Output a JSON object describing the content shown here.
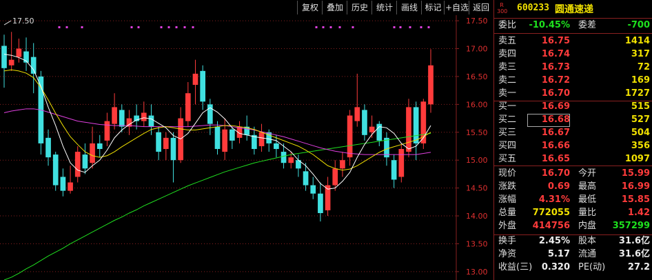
{
  "toolbar": {
    "items": [
      "复权",
      "叠加",
      "历史",
      "统计",
      "画线",
      "标记",
      "+自选",
      "返回"
    ]
  },
  "chart": {
    "y_labels": [
      "17.50",
      "17.00",
      "16.50",
      "16.00",
      "15.50",
      "15.00",
      "14.50",
      "14.00",
      "13.50",
      "13.00"
    ],
    "ymin": 12.85,
    "ymax": 17.6,
    "max_marker": "17.50",
    "colors": {
      "up": "#ff3b3b",
      "down": "#40e0e0",
      "ma5": "#ffffff",
      "ma10": "#f0e000",
      "ma20": "#e040e0",
      "ma60": "#20e020",
      "grid": "#8a2020",
      "dots": "#e040e0"
    },
    "candles": [
      [
        17.05,
        16.65,
        17.25,
        16.3
      ],
      [
        16.7,
        16.8,
        17.3,
        16.6
      ],
      [
        16.85,
        17.0,
        17.18,
        16.75
      ],
      [
        16.95,
        16.75,
        17.2,
        16.6
      ],
      [
        16.85,
        16.55,
        17.1,
        16.2
      ],
      [
        16.5,
        15.3,
        16.6,
        15.1
      ],
      [
        15.4,
        15.05,
        15.55,
        14.9
      ],
      [
        15.1,
        14.55,
        15.15,
        14.45
      ],
      [
        14.7,
        14.45,
        14.85,
        14.35
      ],
      [
        14.45,
        14.6,
        14.9,
        14.4
      ],
      [
        14.7,
        15.15,
        15.25,
        14.6
      ],
      [
        15.1,
        14.85,
        15.3,
        14.75
      ],
      [
        14.95,
        15.3,
        15.6,
        14.85
      ],
      [
        15.3,
        15.2,
        15.45,
        15.05
      ],
      [
        15.35,
        15.7,
        15.85,
        15.25
      ],
      [
        15.65,
        15.95,
        16.2,
        15.55
      ],
      [
        15.9,
        15.6,
        16.0,
        15.5
      ],
      [
        15.6,
        15.75,
        15.9,
        15.45
      ],
      [
        15.8,
        15.7,
        16.0,
        15.55
      ],
      [
        15.7,
        15.85,
        16.05,
        15.6
      ],
      [
        15.8,
        15.6,
        16.0,
        15.45
      ],
      [
        15.5,
        15.15,
        15.6,
        15.0
      ],
      [
        15.2,
        15.4,
        15.5,
        15.0
      ],
      [
        15.4,
        15.0,
        15.5,
        14.6
      ],
      [
        15.0,
        15.75,
        15.95,
        14.95
      ],
      [
        15.7,
        16.2,
        16.4,
        15.6
      ],
      [
        16.35,
        16.55,
        16.8,
        16.0
      ],
      [
        16.6,
        16.05,
        16.7,
        15.9
      ],
      [
        16.0,
        15.65,
        16.1,
        15.45
      ],
      [
        15.6,
        15.2,
        15.7,
        15.1
      ],
      [
        15.15,
        15.55,
        15.75,
        15.0
      ],
      [
        15.55,
        15.35,
        15.6,
        15.2
      ],
      [
        15.4,
        15.6,
        15.7,
        15.3
      ],
      [
        15.6,
        15.45,
        15.8,
        15.35
      ],
      [
        15.45,
        15.2,
        15.6,
        15.1
      ],
      [
        15.25,
        15.5,
        15.65,
        15.15
      ],
      [
        15.5,
        15.3,
        15.55,
        15.15
      ],
      [
        15.3,
        15.2,
        15.45,
        15.05
      ],
      [
        15.15,
        14.95,
        15.3,
        14.85
      ],
      [
        14.95,
        15.05,
        15.15,
        14.85
      ],
      [
        15.0,
        14.85,
        15.1,
        14.7
      ],
      [
        14.8,
        14.55,
        14.95,
        14.45
      ],
      [
        14.55,
        14.4,
        14.7,
        14.3
      ],
      [
        14.4,
        14.05,
        14.6,
        13.9
      ],
      [
        14.1,
        14.55,
        14.7,
        14.0
      ],
      [
        14.55,
        14.85,
        15.0,
        14.45
      ],
      [
        14.85,
        15.0,
        15.15,
        14.7
      ],
      [
        15.05,
        15.8,
        15.9,
        14.9
      ],
      [
        15.7,
        15.95,
        16.55,
        15.6
      ],
      [
        15.9,
        15.45,
        16.0,
        15.35
      ],
      [
        15.5,
        15.6,
        15.8,
        15.4
      ],
      [
        15.65,
        15.35,
        15.7,
        15.25
      ],
      [
        15.4,
        15.05,
        15.5,
        14.9
      ],
      [
        15.0,
        14.65,
        15.1,
        14.5
      ],
      [
        14.7,
        15.2,
        15.3,
        14.6
      ],
      [
        15.15,
        15.95,
        16.1,
        15.05
      ],
      [
        15.95,
        15.3,
        16.05,
        15.0
      ],
      [
        15.3,
        16.05,
        16.1,
        15.2
      ],
      [
        16.0,
        16.7,
        16.99,
        15.85
      ]
    ],
    "ma5": [
      16.9,
      16.88,
      16.84,
      16.78,
      16.62,
      16.32,
      15.95,
      15.62,
      15.25,
      14.95,
      14.82,
      14.78,
      14.9,
      15.0,
      15.18,
      15.4,
      15.54,
      15.64,
      15.72,
      15.76,
      15.74,
      15.66,
      15.58,
      15.44,
      15.38,
      15.48,
      15.66,
      15.85,
      15.94,
      15.86,
      15.74,
      15.58,
      15.48,
      15.45,
      15.42,
      15.4,
      15.38,
      15.35,
      15.25,
      15.15,
      15.0,
      14.9,
      14.75,
      14.58,
      14.48,
      14.5,
      14.62,
      14.78,
      15.05,
      15.28,
      15.46,
      15.6,
      15.58,
      15.48,
      15.3,
      15.2,
      15.25,
      15.4,
      15.62
    ],
    "ma10": [
      16.6,
      16.62,
      16.6,
      16.56,
      16.48,
      16.3,
      16.08,
      15.84,
      15.62,
      15.42,
      15.28,
      15.15,
      15.08,
      15.05,
      15.08,
      15.15,
      15.24,
      15.32,
      15.4,
      15.48,
      15.55,
      15.58,
      15.6,
      15.58,
      15.56,
      15.54,
      15.54,
      15.56,
      15.58,
      15.6,
      15.62,
      15.62,
      15.6,
      15.58,
      15.55,
      15.5,
      15.45,
      15.4,
      15.35,
      15.3,
      15.25,
      15.18,
      15.1,
      15.0,
      14.9,
      14.85,
      14.82,
      14.84,
      14.9,
      14.98,
      15.06,
      15.14,
      15.2,
      15.24,
      15.28,
      15.32,
      15.36,
      15.42,
      15.5
    ],
    "ma20": [
      15.85,
      15.88,
      15.9,
      15.92,
      15.92,
      15.9,
      15.86,
      15.82,
      15.78,
      15.74,
      15.7,
      15.68,
      15.66,
      15.64,
      15.63,
      15.62,
      15.62,
      15.62,
      15.61,
      15.6,
      15.6,
      15.6,
      15.6,
      15.6,
      15.6,
      15.6,
      15.61,
      15.62,
      15.63,
      15.63,
      15.62,
      15.6,
      15.58,
      15.56,
      15.54,
      15.51,
      15.48,
      15.45,
      15.42,
      15.38,
      15.34,
      15.3,
      15.26,
      15.22,
      15.19,
      15.16,
      15.14,
      15.12,
      15.11,
      15.1,
      15.1,
      15.1,
      15.1,
      15.1,
      15.1,
      15.1,
      15.1,
      15.12,
      15.14
    ],
    "ma60": [
      12.85,
      12.9,
      12.97,
      13.05,
      13.12,
      13.2,
      13.28,
      13.35,
      13.42,
      13.5,
      13.57,
      13.64,
      13.71,
      13.78,
      13.85,
      13.92,
      13.98,
      14.05,
      14.11,
      14.18,
      14.24,
      14.3,
      14.36,
      14.42,
      14.48,
      14.54,
      14.59,
      14.64,
      14.69,
      14.74,
      14.79,
      14.83,
      14.87,
      14.91,
      14.95,
      14.98,
      15.01,
      15.04,
      15.07,
      15.1,
      15.12,
      15.14,
      15.16,
      15.18,
      15.2,
      15.22,
      15.24,
      15.26,
      15.28,
      15.3,
      15.32,
      15.34,
      15.36,
      15.38,
      15.4,
      15.42,
      15.44,
      15.46,
      15.48
    ],
    "dots": [
      86,
      97,
      119,
      191,
      201,
      234,
      245,
      256,
      268,
      280,
      459,
      469,
      480,
      493,
      512,
      572,
      581,
      595,
      611,
      622
    ]
  },
  "panel": {
    "badge_top": "R",
    "badge_bottom": "300",
    "code": "600233",
    "name": "圆通速递",
    "weibi_label": "委比",
    "weibi_value": "-10.45%",
    "weicha_label": "委差",
    "weicha_value": "-700",
    "sells": [
      {
        "label": "卖五",
        "price": "16.75",
        "vol": "1414"
      },
      {
        "label": "卖四",
        "price": "16.74",
        "vol": "317"
      },
      {
        "label": "卖三",
        "price": "16.73",
        "vol": "72"
      },
      {
        "label": "卖二",
        "price": "16.72",
        "vol": "169"
      },
      {
        "label": "卖一",
        "price": "16.70",
        "vol": "1727"
      }
    ],
    "buys": [
      {
        "label": "买一",
        "price": "16.69",
        "vol": "515"
      },
      {
        "label": "买二",
        "price": "16.68",
        "vol": "527"
      },
      {
        "label": "买三",
        "price": "16.67",
        "vol": "504"
      },
      {
        "label": "买四",
        "price": "16.66",
        "vol": "356"
      },
      {
        "label": "买五",
        "price": "16.65",
        "vol": "1097"
      }
    ],
    "quote": [
      {
        "l1": "现价",
        "v1": "16.70",
        "c1": "red",
        "l2": "今开",
        "v2": "15.99",
        "c2": "red"
      },
      {
        "l1": "涨跌",
        "v1": "0.69",
        "c1": "red",
        "l2": "最高",
        "v2": "16.99",
        "c2": "red"
      },
      {
        "l1": "涨幅",
        "v1": "4.31%",
        "c1": "red",
        "l2": "最低",
        "v2": "15.85",
        "c2": "red"
      },
      {
        "l1": "总量",
        "v1": "772055",
        "c1": "yellow",
        "l2": "量比",
        "v2": "1.42",
        "c2": "red"
      },
      {
        "l1": "外盘",
        "v1": "414756",
        "c1": "red",
        "l2": "内盘",
        "v2": "357299",
        "c2": "green"
      }
    ],
    "fund": [
      {
        "l1": "换手",
        "v1": "2.45%",
        "l2": "股本",
        "v2": "31.6亿"
      },
      {
        "l1": "净资",
        "v1": "5.17",
        "l2": "流通",
        "v2": "31.6亿"
      },
      {
        "l1": "收益(三)",
        "v1": "0.320",
        "l2": "PE(动)",
        "v2": "27.2"
      }
    ]
  }
}
